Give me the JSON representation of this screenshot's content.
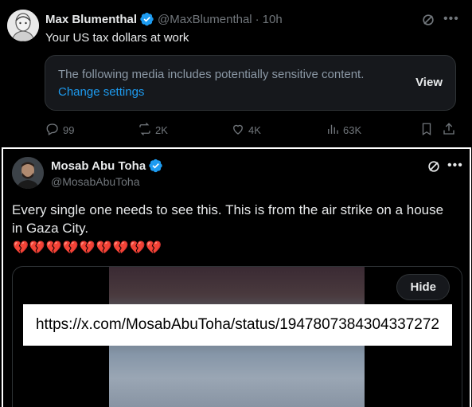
{
  "tweet1": {
    "author_name": "Max Blumenthal",
    "handle": "@MaxBlumenthal",
    "separator": "·",
    "time": "10h",
    "text": "Your US tax dollars at work",
    "sensitive_notice": "The following media includes potentially sensitive content.",
    "change_settings_label": "Change settings",
    "view_label": "View",
    "actions": {
      "replies": "99",
      "reposts": "2K",
      "likes": "4K",
      "views": "63K"
    }
  },
  "tweet2": {
    "author_name": "Mosab Abu Toha",
    "handle": "@MosabAbuToha",
    "text": "Every single one needs to see this. This is from the air strike on a house in Gaza City.",
    "emoji": "💔💔💔💔💔💔💔💔💔",
    "hide_label": "Hide",
    "url": "https://x.com/MosabAbuToha/status/1947807384304337272"
  },
  "colors": {
    "background": "#000000",
    "accent": "#1d9bf0",
    "text_primary": "#e7e9ea",
    "text_secondary": "#71767b",
    "verified": "#1d9bf0"
  },
  "icons": {
    "verified": "verified-badge-icon",
    "grok": "grok-icon",
    "more": "more-icon",
    "reply": "reply-icon",
    "repost": "repost-icon",
    "like": "heart-icon",
    "views": "views-icon",
    "bookmark": "bookmark-icon",
    "share": "share-icon"
  }
}
